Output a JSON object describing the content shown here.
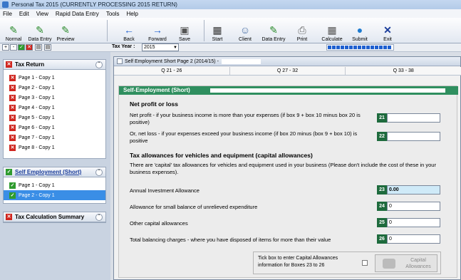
{
  "window": {
    "title": "Personal Tax 2015   (CURRENTLY PROCESSING 2015 RETURN)"
  },
  "menu": [
    "File",
    "Edit",
    "View",
    "Rapid Data Entry",
    "Tools",
    "Help"
  ],
  "toolbar": {
    "normal": "Normal",
    "data_entry": "Data Entry",
    "preview": "Preview",
    "back": "Back",
    "forward": "Forward",
    "save": "Save",
    "start": "Start",
    "client": "Client",
    "data_entry2": "Data Entry",
    "print": "Print",
    "calculate": "Calculate",
    "submit": "Submit",
    "exit": "Exit"
  },
  "strip": {
    "tax_year_label": "Tax Year :",
    "tax_year_value": "2015"
  },
  "sidebar": {
    "tax_return": {
      "title": "Tax Return",
      "items": [
        "Page 1 - Copy 1",
        "Page 2 - Copy 1",
        "Page 3 - Copy 1",
        "Page 4 - Copy 1",
        "Page 5 - Copy 1",
        "Page 6 - Copy 1",
        "Page 7 - Copy 1",
        "Page 8 - Copy 1"
      ]
    },
    "self_employment": {
      "title": "Self Employment (Short)",
      "items": [
        "Page 1 - Copy 1",
        "Page 2 - Copy 1"
      ]
    },
    "tax_calc": {
      "title": "Tax Calculation Summary"
    }
  },
  "dialog": {
    "title": "Self Employment Short Page 2 (2014/15) -",
    "tabs": [
      "Q 21 - 26",
      "Q 27 - 32",
      "Q 33 - 38"
    ],
    "section_header": "Self-Employment (Short)",
    "net_heading": "Net profit or loss",
    "q21_text": "Net profit - if your business income is more than your expenses (if box 9 + box 10 minus box 20 is positive)",
    "q21_num": "21",
    "q22_text": "Or, net loss - if your expenses exceed your business income (if box 20 minus (box 9 + box 10) is positive",
    "q22_num": "22",
    "cap_heading": "Tax allowances for vehicles and equipment (capital allowances)",
    "cap_intro": "There are 'capital' tax allowances for vehicles and equipment used in your business (Please don't include the cost of these in your business expenses).",
    "q23_text": "Annual Investment Allowance",
    "q23_num": "23",
    "q23_val": "0.00",
    "q24_text": "Allowance for small balance of unrelieved expenditure",
    "q24_num": "24",
    "q24_val": "0",
    "q25_text": "Other capital allowances",
    "q25_num": "25",
    "q25_val": "0",
    "q26_text": "Total balancing charges - where you have disposed of items for more than their value",
    "q26_num": "26",
    "q26_val": "0",
    "tick_text": "Tick box to enter Capital Allowances information for Boxes 23 to 26",
    "cap_button": "Capital Allowances"
  }
}
